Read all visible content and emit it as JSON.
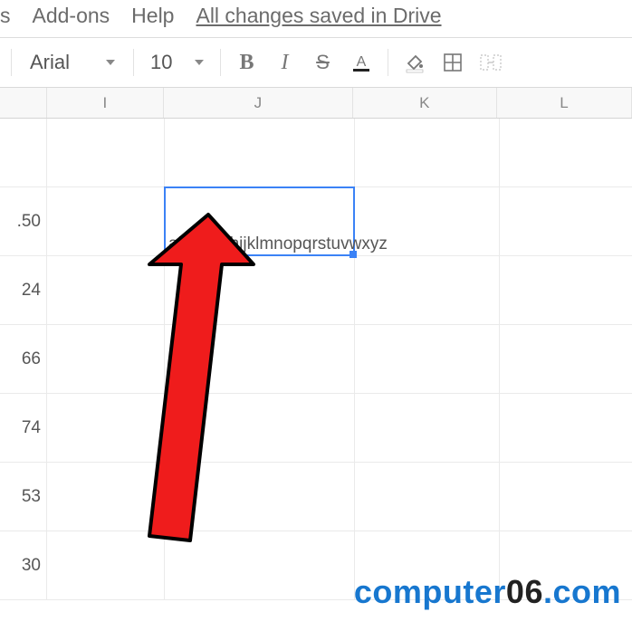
{
  "menu": {
    "items": [
      "s",
      "Add-ons",
      "Help"
    ],
    "save_status": "All changes saved in Drive"
  },
  "toolbar": {
    "font_name": "Arial",
    "font_size": "10"
  },
  "columns": {
    "widths": [
      52,
      130,
      210,
      160,
      150
    ],
    "labels": [
      "",
      "I",
      "J",
      "K",
      "L"
    ]
  },
  "rows": {
    "height": 76,
    "partial_values": [
      ".50",
      "24",
      "66",
      "74",
      "53",
      "30"
    ],
    "selected_cell_value": "abcdefghijklmnopqrstuvwxyz",
    "selected": {
      "col_index": 2,
      "row_index": 1
    }
  },
  "watermark": {
    "text1": "computer",
    "text2": "06",
    "text3": ".com"
  }
}
